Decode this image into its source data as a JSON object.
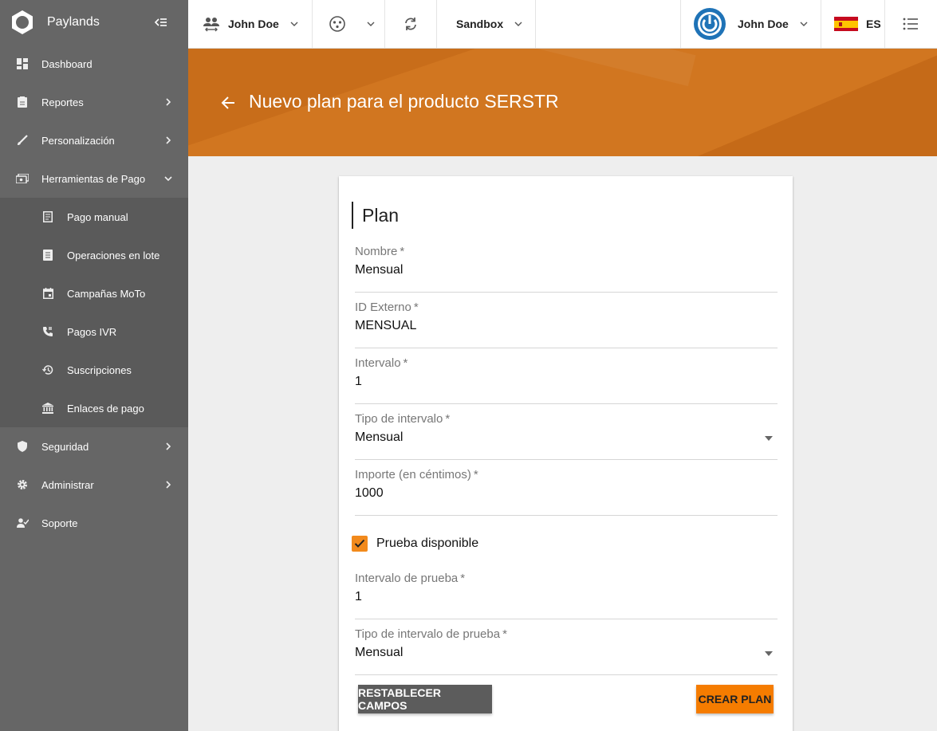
{
  "brand": {
    "name": "Paylands"
  },
  "sidebar": {
    "items": [
      {
        "label": "Dashboard"
      },
      {
        "label": "Reportes"
      },
      {
        "label": "Personalización"
      },
      {
        "label": "Herramientas de Pago"
      },
      {
        "label": "Seguridad"
      },
      {
        "label": "Administrar"
      },
      {
        "label": "Soporte"
      }
    ],
    "subitems": [
      {
        "label": "Pago manual"
      },
      {
        "label": "Operaciones en lote"
      },
      {
        "label": "Campañas MoTo"
      },
      {
        "label": "Pagos IVR"
      },
      {
        "label": "Suscripciones"
      },
      {
        "label": "Enlaces de pago"
      }
    ]
  },
  "topbar": {
    "user": "John Doe",
    "environment": "Sandbox",
    "account": "John Doe",
    "language": "ES"
  },
  "header": {
    "title": "Nuevo plan para el producto SERSTR"
  },
  "form": {
    "title": "Plan",
    "required_mark": "*",
    "fields": [
      {
        "label": "Nombre",
        "value": "Mensual"
      },
      {
        "label": "ID Externo",
        "value": "MENSUAL"
      },
      {
        "label": "Intervalo",
        "value": "1"
      },
      {
        "label": "Tipo de intervalo",
        "value": "Mensual"
      },
      {
        "label": "Importe (en céntimos)",
        "value": "1000"
      },
      {
        "label": "Intervalo de prueba",
        "value": "1"
      },
      {
        "label": "Tipo de intervalo de prueba",
        "value": "Mensual"
      }
    ],
    "trial_checkbox": {
      "label": "Prueba disponible",
      "checked": true
    },
    "reset_button": "RESTABLECER CAMPOS",
    "create_button": "CREAR PLAN"
  },
  "colors": {
    "accent": "#f57c00",
    "banner": "#d17620",
    "sidebar": "#666666",
    "account_icon": "#1f73b7"
  }
}
